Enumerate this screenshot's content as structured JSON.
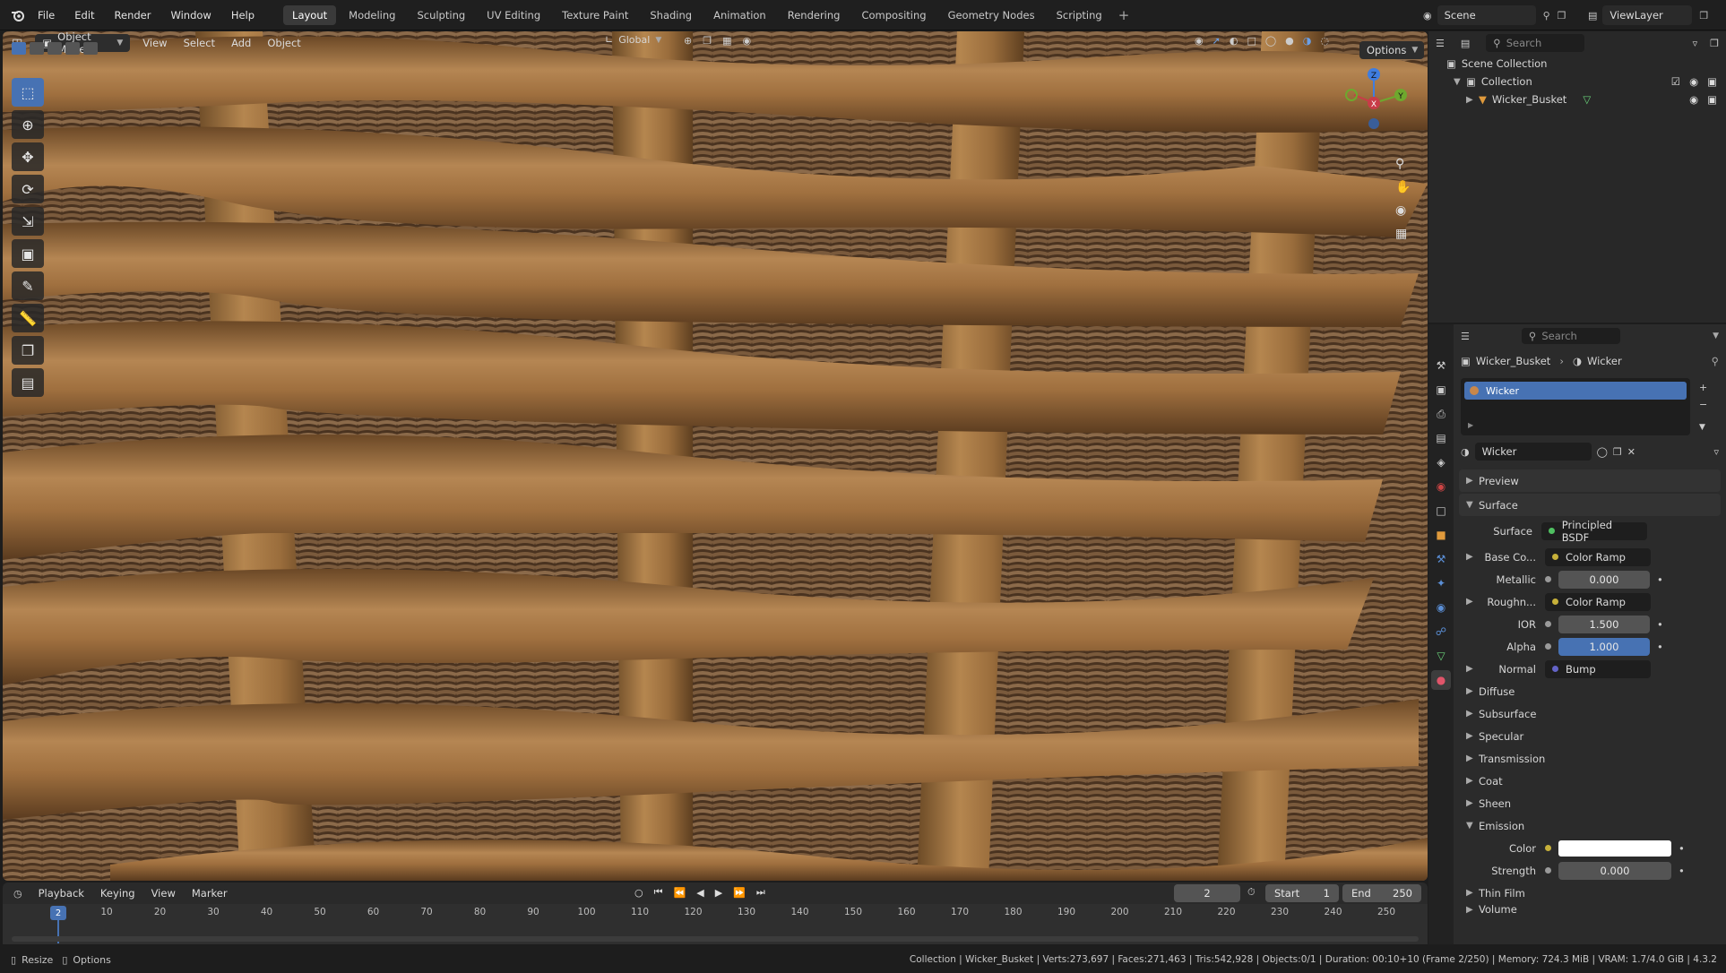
{
  "topbar": {
    "menus": [
      "File",
      "Edit",
      "Render",
      "Window",
      "Help"
    ],
    "workspaces": [
      "Layout",
      "Modeling",
      "Sculpting",
      "UV Editing",
      "Texture Paint",
      "Shading",
      "Animation",
      "Rendering",
      "Compositing",
      "Geometry Nodes",
      "Scripting"
    ],
    "active_workspace": "Layout",
    "scene": "Scene",
    "view_layer": "ViewLayer"
  },
  "viewport": {
    "mode": "Object Mode",
    "menus": [
      "View",
      "Select",
      "Add",
      "Object"
    ],
    "orientation": "Global",
    "options_label": "Options",
    "gizmo": {
      "x": "X",
      "y": "Y",
      "z": "Z"
    }
  },
  "outliner": {
    "search_placeholder": "Search",
    "scene_collection": "Scene Collection",
    "collection": "Collection",
    "object": "Wicker_Busket"
  },
  "properties": {
    "search_placeholder": "Search",
    "breadcrumb_object": "Wicker_Busket",
    "breadcrumb_material": "Wicker",
    "slot_name": "Wicker",
    "material_name": "Wicker",
    "sections": {
      "preview": "Preview",
      "surface": "Surface"
    },
    "surface_label": "Surface",
    "surface_value": "Principled BSDF",
    "inputs": [
      {
        "label": "Base Co...",
        "value": "Color Ramp",
        "type": "link",
        "dot": "#c7b13a",
        "expand": true
      },
      {
        "label": "Metallic",
        "value": "0.000",
        "type": "num",
        "dot": "#9a9a9a"
      },
      {
        "label": "Roughn...",
        "value": "Color Ramp",
        "type": "link",
        "dot": "#c7b13a",
        "expand": true
      },
      {
        "label": "IOR",
        "value": "1.500",
        "type": "num",
        "dot": "#9a9a9a"
      },
      {
        "label": "Alpha",
        "value": "1.000",
        "type": "numblue",
        "dot": "#9a9a9a"
      },
      {
        "label": "Normal",
        "value": "Bump",
        "type": "link",
        "dot": "#6363c7",
        "expand": true
      }
    ],
    "subpanels": [
      "Diffuse",
      "Subsurface",
      "Specular",
      "Transmission",
      "Coat",
      "Sheen"
    ],
    "emission": {
      "label": "Emission",
      "color_label": "Color",
      "strength_label": "Strength",
      "strength_value": "0.000"
    },
    "thin_film": "Thin Film",
    "volume": "Volume"
  },
  "timeline": {
    "menus": [
      "Playback",
      "Keying",
      "View",
      "Marker"
    ],
    "current_frame": "2",
    "start_label": "Start",
    "start_value": "1",
    "end_label": "End",
    "end_value": "250",
    "ticks": [
      "10",
      "20",
      "30",
      "40",
      "50",
      "60",
      "70",
      "80",
      "90",
      "100",
      "110",
      "120",
      "130",
      "140",
      "150",
      "160",
      "170",
      "180",
      "190",
      "200",
      "210",
      "220",
      "230",
      "240",
      "250"
    ],
    "playhead": "2"
  },
  "statusbar": {
    "left_1": "Resize",
    "left_2": "Options",
    "stats": "Collection | Wicker_Busket | Verts:273,697 | Faces:271,463 | Tris:542,928 | Objects:0/1 | Duration: 00:10+10 (Frame 2/250) | Memory: 724.3 MiB | VRAM: 1.7/4.0 GiB | 4.3.2"
  },
  "colors": {
    "accent": "#4772b3",
    "wood_light": "#a9794a",
    "wood_dark": "#5c3d22"
  }
}
